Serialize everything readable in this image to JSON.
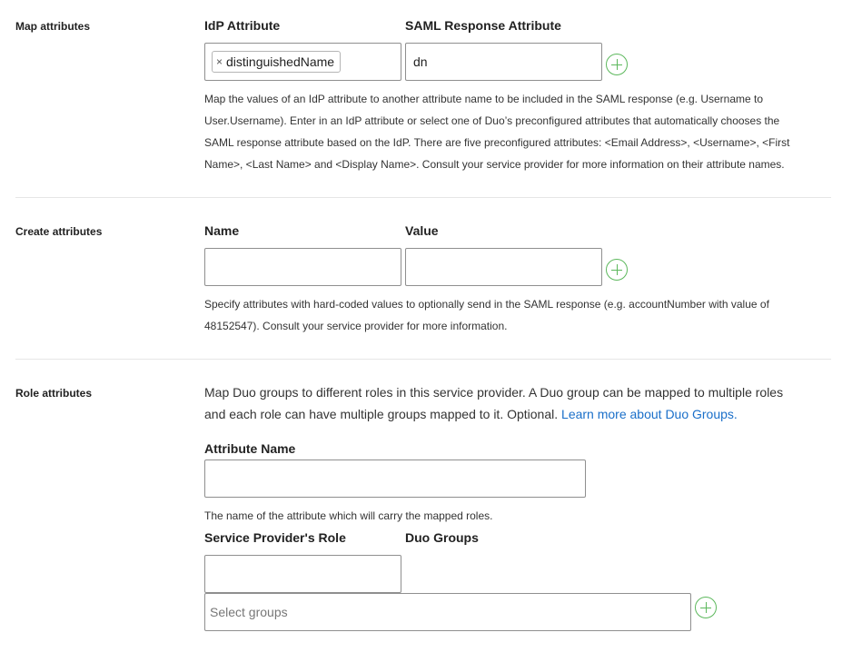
{
  "map_attributes": {
    "section_label": "Map attributes",
    "col1_header": "IdP Attribute",
    "col2_header": "SAML Response Attribute",
    "idp_token": "distinguishedName",
    "token_remove": "×",
    "saml_value": "dn",
    "help_lines": [
      "Map the values of an IdP attribute to another attribute name to be included in the SAML response (e.g. Username to",
      "User.Username). Enter in an IdP attribute or select one of Duo’s preconfigured attributes that automatically chooses the",
      "SAML response attribute based on the IdP. There are five preconfigured attributes: <Email Address>, <Username>, <First",
      "Name>, <Last Name> and <Display Name>. Consult your service provider for more information on their attribute names."
    ]
  },
  "create_attributes": {
    "section_label": "Create attributes",
    "col1_header": "Name",
    "col2_header": "Value",
    "help_lines": [
      "Specify attributes with hard-coded values to optionally send in the SAML response (e.g. accountNumber with value of",
      "48152547). Consult your service provider for more information."
    ]
  },
  "role_attributes": {
    "section_label": "Role attributes",
    "desc_line1": "Map Duo groups to different roles in this service provider. A Duo group can be mapped to multiple roles",
    "desc_line2": "and each role can have multiple groups mapped to it. Optional.",
    "learn_more_link": "Learn more about Duo Groups.",
    "attribute_name_label": "Attribute Name",
    "attribute_name_help": "The name of the attribute which will carry the mapped roles.",
    "sp_role_header": "Service Provider's Role",
    "duo_groups_header": "Duo Groups",
    "groups_placeholder": "Select groups"
  },
  "icons": {
    "add": "plus-circle-icon",
    "remove_token": "close-icon"
  },
  "colors": {
    "add_icon": "#5cb85c",
    "link": "#1a6fc9",
    "border": "#8f8f8f",
    "divider": "#e6e6e6"
  }
}
